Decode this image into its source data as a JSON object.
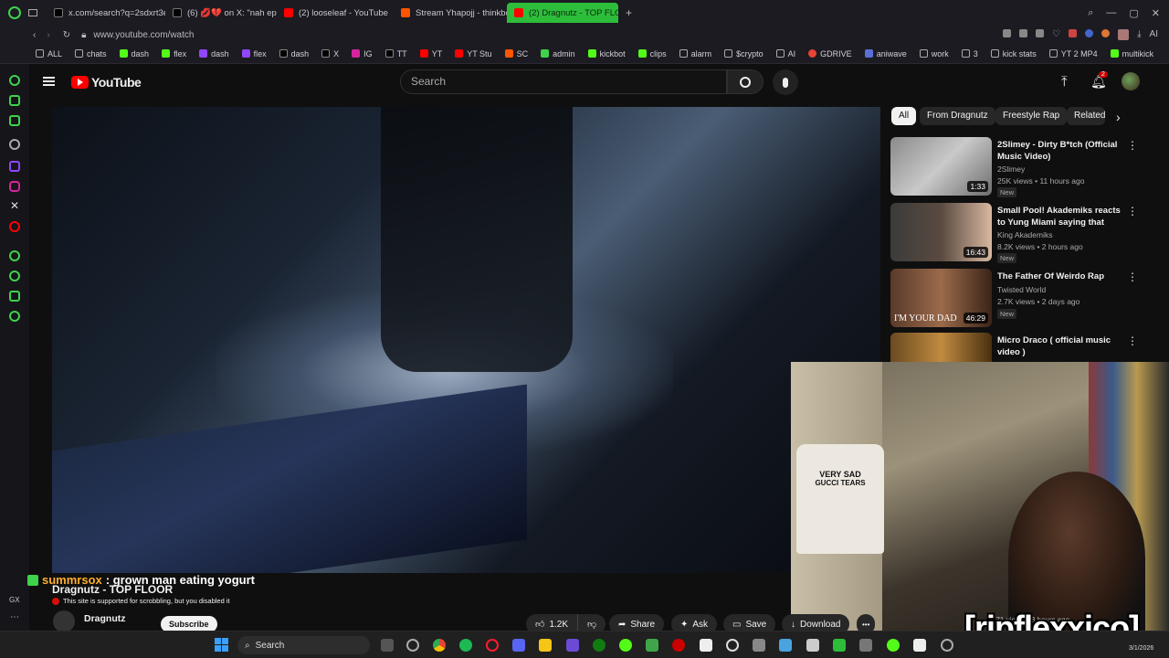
{
  "browser": {
    "tabs": [
      {
        "title": "x.com/search?q=2sdxrt3e",
        "color": "#ffffff"
      },
      {
        "title": "(6) 💋💔 on X: \"nah ep",
        "color": "#ffffff"
      },
      {
        "title": "(2) looseleaf - YouTube",
        "color": "#ff0000"
      },
      {
        "title": "Stream Yhapojj - thinkbo",
        "color": "#ff5500"
      },
      {
        "title": "(2) Dragnutz - TOP FLOOR",
        "color": "#ff0000"
      }
    ],
    "new_tab": "+",
    "url": "www.youtube.com/watch",
    "bookmarks": [
      "ALL",
      "chats",
      "dash",
      "flex",
      "dash",
      "flex",
      "dash",
      "X",
      "IG",
      "TT",
      "YT",
      "YT Stu",
      "SC",
      "admin",
      "kickbot",
      "clips",
      "alarm",
      "$crypto",
      "AI",
      "GDRIVE",
      "aniwave",
      "work",
      "3",
      "kick stats",
      "YT 2 MP4",
      "multikick"
    ]
  },
  "youtube": {
    "logo": "YouTube",
    "search_placeholder": "Search",
    "notification_count": "2",
    "chips": [
      "All",
      "From Dragnutz",
      "Freestyle Rap",
      "Related"
    ],
    "recommendations": [
      {
        "title": "2Slimey - Dirty B*tch (Official Music Video)",
        "channel": "2Slimey",
        "meta": "25K views • 11 hours ago",
        "badge": "New",
        "duration": "1:33",
        "colors": [
          "#8a8a8a",
          "#c9c9c9"
        ]
      },
      {
        "title": "Small Pool! Akademiks reacts to Yung Miami saying that she...",
        "channel": "King Akademiks",
        "meta": "8.2K views • 2 hours ago",
        "badge": "New",
        "duration": "16:43",
        "colors": [
          "#3b3b3b",
          "#d8b8a0"
        ]
      },
      {
        "title": "The Father Of Weirdo Rap",
        "channel": "Twisted World",
        "meta": "2.7K views • 2 days ago",
        "badge": "New",
        "duration": "46:29",
        "colors": [
          "#5a3a2a",
          "#9b6a4a"
        ]
      },
      {
        "title": "Micro Draco ( official music video )",
        "channel": "",
        "meta": "",
        "badge": "",
        "duration": "",
        "colors": [
          "#6a4a20",
          "#c08a40"
        ]
      }
    ],
    "thumb_caption": "I'M YOUR DAD",
    "chat_user": "summrsox",
    "chat_message": ": grown man eating yogurt",
    "video_title": "Dragnutz - TOP FLOOR",
    "scrobble_notice": "This site is supported for scrobbling, but you disabled it",
    "channel_name": "Dragnutz",
    "subscribe": "Subscribe",
    "likes": "1.2K",
    "actions": {
      "share": "Share",
      "ask": "Ask",
      "save": "Save",
      "download": "Download",
      "more": "•••"
    }
  },
  "webcam": {
    "shirt_text_1": "VERY SAD",
    "shirt_text_2": "GUCCI TEARS",
    "watermark": "[ripflexxico]",
    "corner_text": "171 views • 3 hours ago"
  },
  "taskbar": {
    "search": "Search",
    "date": "3/1/2026"
  },
  "colors": {
    "accent_green": "#2dbd3a",
    "yt_red": "#ff0000",
    "chat_name": "#ffb02e"
  }
}
